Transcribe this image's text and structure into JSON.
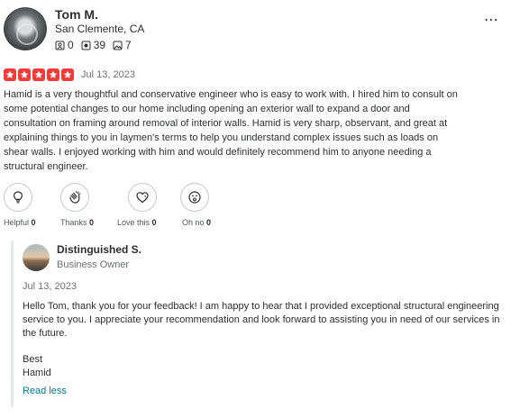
{
  "review": {
    "user": {
      "name": "Tom M.",
      "location": "San Clemente, CA",
      "friends": "0",
      "reviews": "39",
      "photos": "7"
    },
    "more_menu": "⋯",
    "rating": 5,
    "date": "Jul 13, 2023",
    "text": "Hamid is a very thoughtful and conservative engineer who is easy to work with. I hired him to consult on some potential changes to our home including opening an exterior wall to expand a door and consultation on framing around removal of interior walls. Hamid is very sharp, observant, and great at explaining things to you in laymen's terms to help you understand complex issues such as loads on shear walls. I enjoyed working with him and would definitely recommend him to anyone needing a structural engineer.",
    "reactions": [
      {
        "label": "Helpful",
        "count": "0",
        "icon": "lightbulb-icon"
      },
      {
        "label": "Thanks",
        "count": "0",
        "icon": "clapping-hands-icon"
      },
      {
        "label": "Love this",
        "count": "0",
        "icon": "heart-icon"
      },
      {
        "label": "Oh no",
        "count": "0",
        "icon": "surprised-face-icon"
      }
    ]
  },
  "owner_reply": {
    "name": "Distinguished S.",
    "role": "Business Owner",
    "date": "Jul 13, 2023",
    "text": "Hello Tom, thank you for your feedback! I am happy to hear that I provided exceptional structural engineering service to you. I appreciate your recommendation and look forward to assisting you in need of our services in the future.",
    "sign_line1": "Best",
    "sign_line2": "Hamid",
    "read_less": "Read less"
  },
  "colors": {
    "star_red": "#f43939",
    "link_teal": "#027a97"
  }
}
